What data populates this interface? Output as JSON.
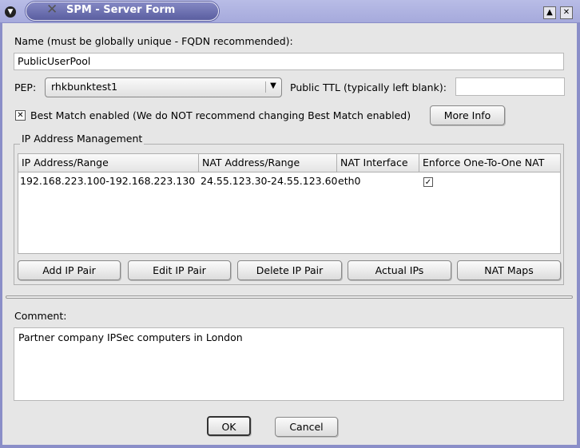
{
  "window": {
    "title": "SPM - Server Form",
    "menu_icon": "chevron-down-circle",
    "app_icon": "x-logo",
    "controls": [
      "maximize",
      "close"
    ]
  },
  "form": {
    "name_label": "Name (must be globally unique - FQDN recommended):",
    "name_value": "PublicUserPool",
    "pep_label": "PEP:",
    "pep_selected": "rhkbunktest1",
    "ttl_label": "Public TTL (typically left blank):",
    "ttl_value": "",
    "best_match_label": "Best Match enabled (We do NOT recommend changing Best Match enabled)",
    "best_match_checked": true,
    "more_info_label": "More Info"
  },
  "ip_management": {
    "group_title": "IP Address Management",
    "columns": [
      "IP Address/Range",
      "NAT Address/Range",
      "NAT Interface",
      "Enforce One-To-One NAT"
    ],
    "rows": [
      {
        "ip": "192.168.223.100-192.168.223.130",
        "nat": "24.55.123.30-24.55.123.60",
        "iface": "eth0",
        "enforce": true
      }
    ],
    "buttons": [
      "Add IP Pair",
      "Edit IP Pair",
      "Delete IP Pair",
      "Actual IPs",
      "NAT Maps"
    ]
  },
  "comment": {
    "label": "Comment:",
    "value": "Partner company IPSec computers in London"
  },
  "dialog_buttons": {
    "ok": "OK",
    "cancel": "Cancel"
  }
}
